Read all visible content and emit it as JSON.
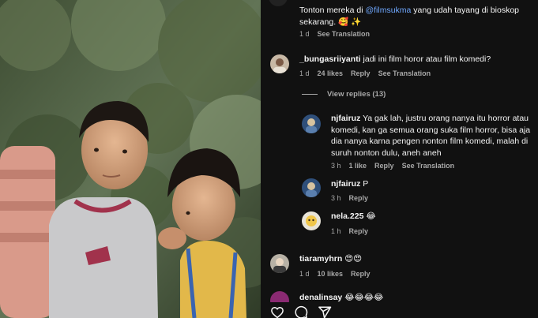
{
  "post": {
    "caption_prefix": "Tonton mereka di ",
    "caption_mention": "@filmsukma",
    "caption_suffix": " yang udah tayang di bioskop sekarang. 🥰 ✨",
    "caption_time": "1 d",
    "caption_translate": "See Translation"
  },
  "comments": [
    {
      "username": "_bungasriiyanti",
      "text": "jadi ini film horor atau film komedi?",
      "time": "1 d",
      "likes": "24 likes",
      "reply": "Reply",
      "translate": "See Translation"
    },
    {
      "username": "tiaramyhrn",
      "text": "😍😍",
      "time": "1 d",
      "likes": "10 likes",
      "reply": "Reply"
    },
    {
      "username": "denalinsay",
      "text": "😂😂😂😂"
    }
  ],
  "view_replies": "View replies (13)",
  "replies": [
    {
      "username": "njfairuz",
      "text": "Ya gak lah, justru orang nanya itu horror atau komedi, kan ga semua orang suka film horror, bisa aja dia nanya karna pengen nonton film komedi, malah di suruh nonton dulu, aneh aneh",
      "time": "3 h",
      "likes": "1 like",
      "reply": "Reply",
      "translate": "See Translation"
    },
    {
      "username": "njfairuz",
      "text": "P",
      "time": "3 h",
      "reply": "Reply"
    },
    {
      "username": "nela.225",
      "text": "😂",
      "time": "1 h",
      "reply": "Reply"
    }
  ],
  "actions": {
    "like_icon": "heart-icon",
    "comment_icon": "comment-icon",
    "share_icon": "send-icon"
  },
  "colors": {
    "panel_bg": "#111111",
    "text": "#f5f5f5",
    "muted": "#a8a8a8",
    "mention": "#6fa8ff"
  }
}
